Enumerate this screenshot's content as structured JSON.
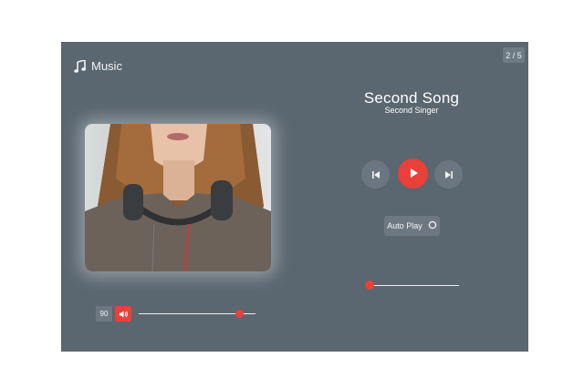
{
  "app": {
    "title": "Music",
    "icon": "music-note-icon",
    "page_counter": "2 / 5"
  },
  "track": {
    "title": "Second Song",
    "artist": "Second Singer",
    "progress_fraction": 0.0
  },
  "controls": {
    "prev_icon": "skip-previous-icon",
    "play_icon": "play-icon",
    "next_icon": "skip-next-icon",
    "autoplay_label": "Auto Play",
    "autoplay_icon": "circle-toggle-icon"
  },
  "volume": {
    "value": "90",
    "icon": "speaker-icon",
    "level_fraction": 0.85
  },
  "colors": {
    "panel": "#5a6670",
    "accent": "#e9403a",
    "secondary_button": "#6b7680"
  }
}
